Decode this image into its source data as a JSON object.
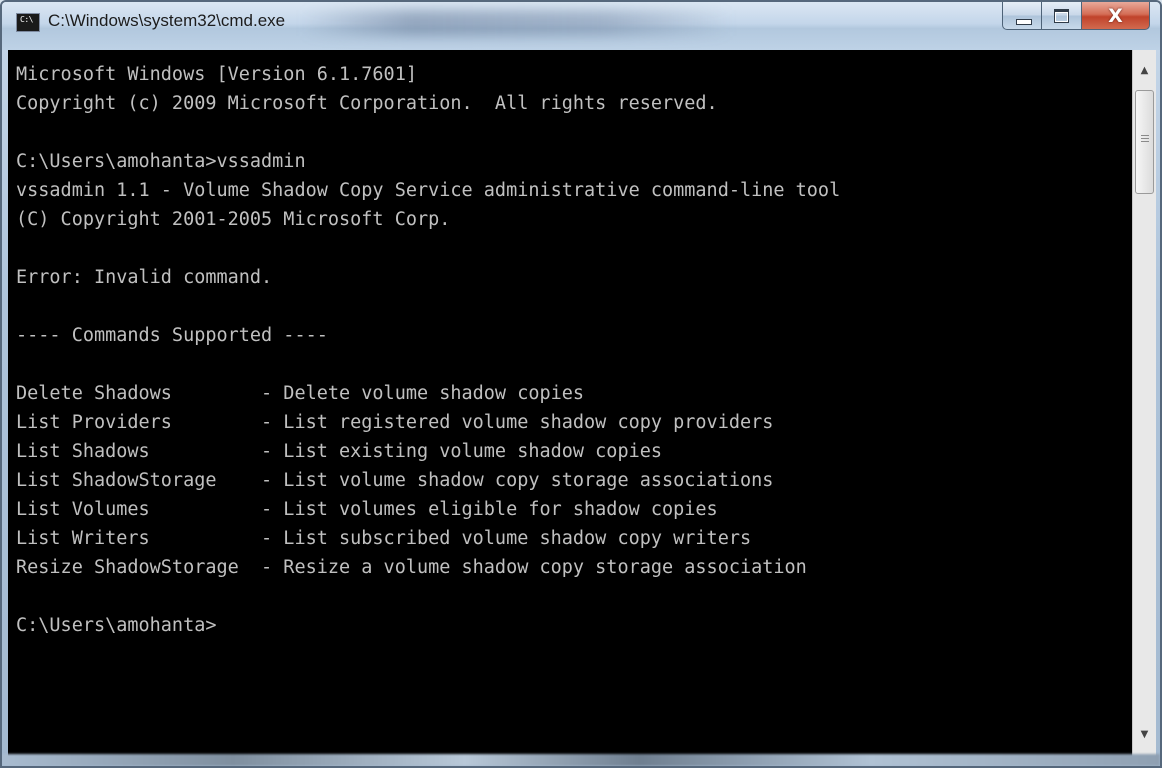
{
  "window": {
    "title": "C:\\Windows\\system32\\cmd.exe",
    "icon_text": "C:\\",
    "controls": {
      "minimize_icon": "minimize-icon",
      "maximize_icon": "maximize-icon",
      "close_icon": "close-icon",
      "close_glyph": "X"
    }
  },
  "console": {
    "lines": [
      "Microsoft Windows [Version 6.1.7601]",
      "Copyright (c) 2009 Microsoft Corporation.  All rights reserved.",
      "",
      "C:\\Users\\amohanta>vssadmin",
      "vssadmin 1.1 - Volume Shadow Copy Service administrative command-line tool",
      "(C) Copyright 2001-2005 Microsoft Corp.",
      "",
      "Error: Invalid command.",
      "",
      "---- Commands Supported ----",
      "",
      "Delete Shadows        - Delete volume shadow copies",
      "List Providers        - List registered volume shadow copy providers",
      "List Shadows          - List existing volume shadow copies",
      "List ShadowStorage    - List volume shadow copy storage associations",
      "List Volumes          - List volumes eligible for shadow copies",
      "List Writers          - List subscribed volume shadow copy writers",
      "Resize ShadowStorage  - Resize a volume shadow copy storage association",
      "",
      "C:\\Users\\amohanta>"
    ]
  },
  "colors": {
    "console_background": "#000000",
    "console_text": "#c0c0c0",
    "close_button": "#c0432b"
  }
}
